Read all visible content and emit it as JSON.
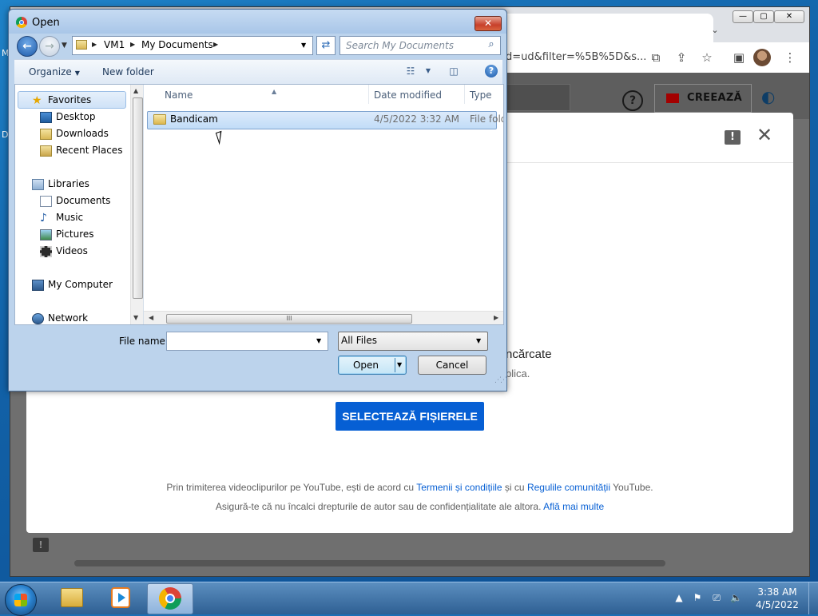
{
  "desktop": {
    "fragment_1": "M",
    "fragment_2": "D"
  },
  "chrome": {
    "url_fragment": "d=ud&filter=%5B%5D&s...",
    "window_buttons": {
      "minimize": "—",
      "maximize": "▢",
      "close": "✕"
    }
  },
  "youtube": {
    "create_label": "CREEAZĂ",
    "help_glyph": "?",
    "feedback_glyph": "!",
    "close_glyph": "✕",
    "upload_title_fragment": "ncărcate",
    "upload_subtitle_fragment": "blica.",
    "select_files_label": "SELECTEAZĂ FIȘIERELE",
    "legal": {
      "line1_prefix": "Prin trimiterea videoclipurilor pe YouTube, ești de acord cu ",
      "line1_link1": "Termenii și condițiile",
      "line1_mid": " și cu ",
      "line1_link2": "Regulile comunității",
      "line1_suffix": " YouTube.",
      "line2_prefix": "Asigură-te că nu încalci drepturile de autor sau de confidențialitate ale altora. ",
      "line2_link": "Află mai multe"
    }
  },
  "dialog": {
    "title": "Open",
    "close_glyph": "✕",
    "breadcrumb": [
      "VM1",
      "My Documents"
    ],
    "search_placeholder": "Search My Documents",
    "toolbar": {
      "organize_label": "Organize",
      "new_folder_label": "New folder"
    },
    "nav_pane": {
      "favorites": "Favorites",
      "desktop": "Desktop",
      "downloads": "Downloads",
      "recent_places": "Recent Places",
      "libraries": "Libraries",
      "documents": "Documents",
      "music": "Music",
      "pictures": "Pictures",
      "videos": "Videos",
      "my_computer": "My Computer",
      "network": "Network"
    },
    "columns": {
      "name": "Name",
      "date_modified": "Date modified",
      "type": "Type"
    },
    "files": [
      {
        "name": "Bandicam",
        "date_modified": "4/5/2022 3:32 AM",
        "type": "File folder"
      }
    ],
    "file_name_label": "File name:",
    "file_name_value": "",
    "file_type_value": "All Files",
    "open_label": "Open",
    "cancel_label": "Cancel",
    "hscroll_grip": "III"
  },
  "taskbar": {
    "clock_time": "3:38 AM",
    "clock_date": "4/5/2022"
  }
}
